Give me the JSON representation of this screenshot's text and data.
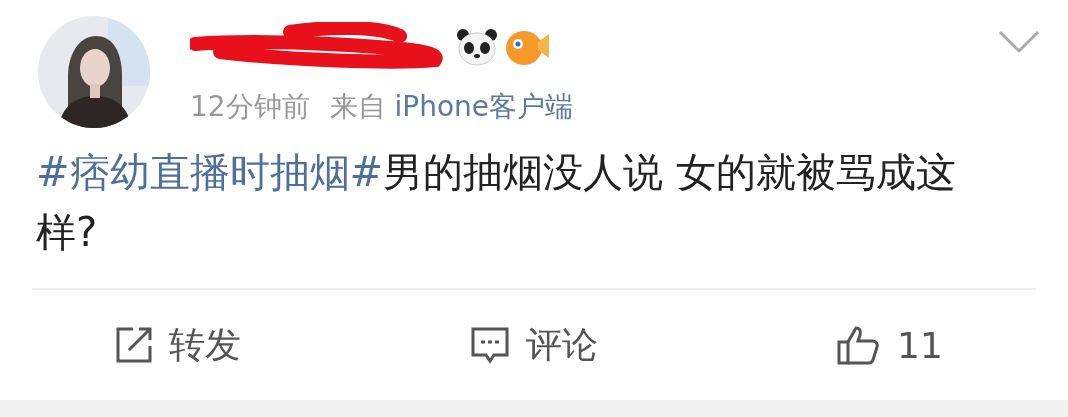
{
  "post": {
    "time": "12分钟前",
    "source_prefix": "来自",
    "source": "iPhone客户端",
    "hashtag": "#痞幼直播时抽烟#",
    "text": "男的抽烟没人说 女的就被骂成这样?"
  },
  "actions": [
    {
      "kind": "repost",
      "label": "转发"
    },
    {
      "kind": "comment",
      "label": "评论"
    },
    {
      "kind": "like",
      "label": "11"
    }
  ]
}
